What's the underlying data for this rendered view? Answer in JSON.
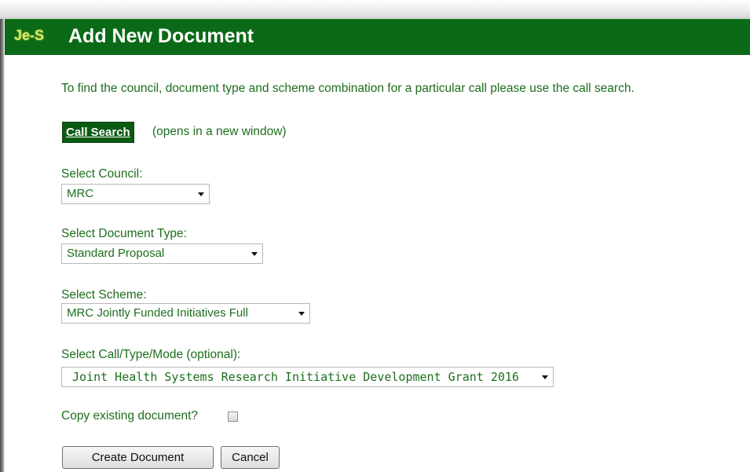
{
  "header": {
    "logo": "Je-S",
    "title": "Add New Document"
  },
  "intro_text": "To find the council, document type and scheme combination for a particular call please use the call search.",
  "call_search": {
    "button_label": "Call Search",
    "note": "(opens in a new window)"
  },
  "fields": {
    "council": {
      "label": "Select Council:",
      "value": "MRC"
    },
    "document_type": {
      "label": "Select Document Type:",
      "value": "Standard Proposal"
    },
    "scheme": {
      "label": "Select Scheme:",
      "value": "MRC Jointly Funded Initiatives Full"
    },
    "call": {
      "label": "Select Call/Type/Mode (optional):",
      "value": "Joint Health Systems Research Initiative Development Grant 2016"
    }
  },
  "copy_existing": {
    "label": "Copy existing document?",
    "checked": false
  },
  "actions": {
    "create_label": "Create Document",
    "cancel_label": "Cancel"
  },
  "colors": {
    "brand_green": "#0b6a17",
    "text_green": "#1d6e1d",
    "logo_yellow": "#d9e96a"
  }
}
